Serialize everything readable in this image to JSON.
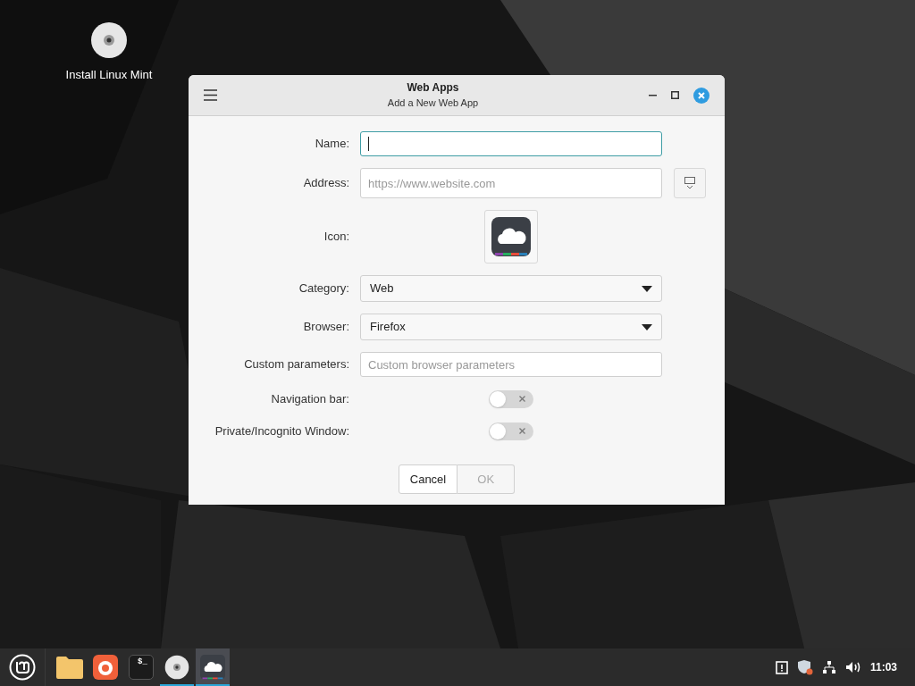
{
  "desktop": {
    "icons": [
      {
        "label": "Install Linux Mint"
      }
    ]
  },
  "window": {
    "title": "Web Apps",
    "subtitle": "Add a New Web App",
    "rows": [
      {
        "kind": "text",
        "label": "Name:",
        "value": "",
        "placeholder": "",
        "focused": true
      },
      {
        "kind": "text-button",
        "label": "Address:",
        "placeholder": "https://www.website.com",
        "focused": false
      },
      {
        "kind": "icon",
        "label": "Icon:"
      },
      {
        "kind": "select",
        "label": "Category:",
        "value": "Web"
      },
      {
        "kind": "select",
        "label": "Browser:",
        "value": "Firefox"
      },
      {
        "kind": "text",
        "label": "Custom parameters:",
        "placeholder": "Custom browser parameters",
        "focused": false
      },
      {
        "kind": "toggle",
        "label": "Navigation bar:",
        "on": false
      },
      {
        "kind": "toggle",
        "label": "Private/Incognito Window:",
        "on": false
      }
    ],
    "buttons": [
      {
        "label": "Cancel",
        "disabled": false
      },
      {
        "label": "OK",
        "disabled": true
      }
    ]
  },
  "taskbar": {
    "items": [
      {
        "kind": "folder",
        "running": false,
        "active": false
      },
      {
        "kind": "firefox",
        "running": false,
        "active": false
      },
      {
        "kind": "terminal",
        "glyph": "$_",
        "running": false,
        "active": false
      },
      {
        "kind": "disc",
        "running": true,
        "active": false
      },
      {
        "kind": "webapps",
        "running": true,
        "active": true
      }
    ],
    "clock": "11:03"
  }
}
